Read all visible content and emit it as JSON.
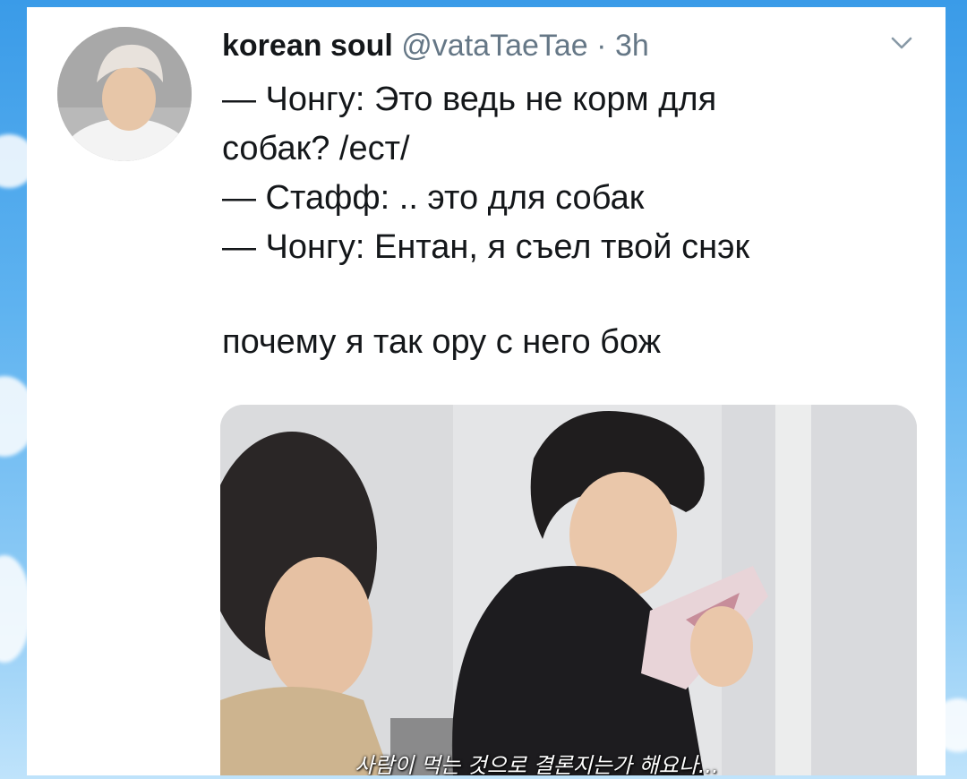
{
  "tweet": {
    "display_name": "korean soul",
    "handle": "@vataTaeTae",
    "separator": "·",
    "time": "3h",
    "lines": [
      "— Чонгу: Это ведь не корм для",
      "собак? /ест/",
      "— Стафф: .. это для собак",
      "— Чонгу: Ентан, я съел твой снэк",
      "",
      "почему я так ору с него бож"
    ]
  },
  "media": {
    "subtitle": "사람이 먹는 것으로 결론지는가 해요나..."
  },
  "icons": {
    "menu": "chevron-down-icon"
  },
  "colors": {
    "text": "#14171a",
    "secondary": "#657786",
    "background_sky": "#5fb3f0"
  }
}
